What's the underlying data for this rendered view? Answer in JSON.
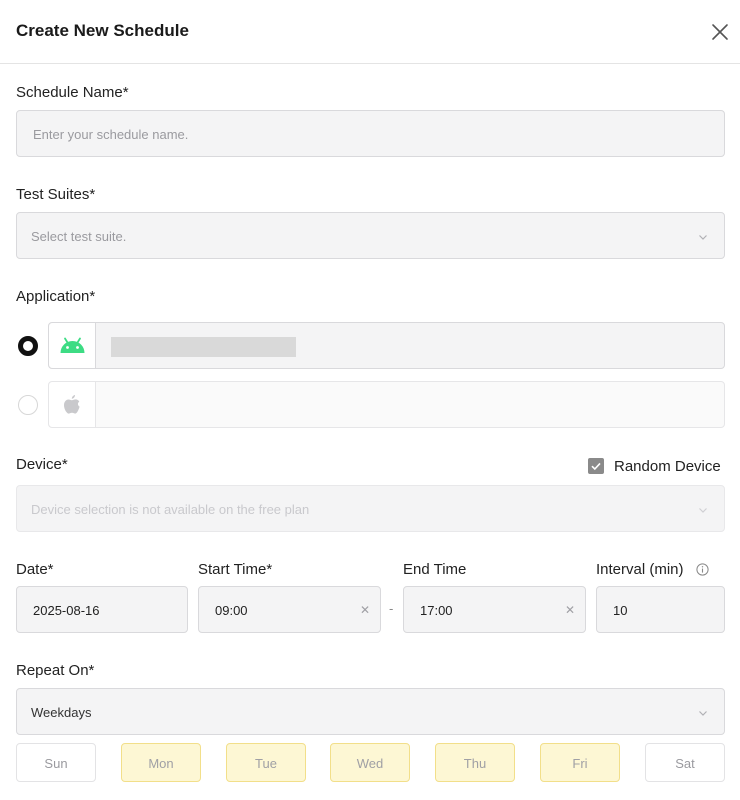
{
  "header": {
    "title": "Create New Schedule",
    "close_icon": "close-icon"
  },
  "schedule_name": {
    "label": "Schedule Name*",
    "placeholder": "Enter your schedule name."
  },
  "test_suites": {
    "label": "Test Suites*",
    "placeholder": "Select test suite."
  },
  "application": {
    "label": "Application*",
    "options": [
      {
        "platform": "android",
        "icon": "android-icon",
        "selected": true,
        "name_redacted": true
      },
      {
        "platform": "ios",
        "icon": "apple-icon",
        "selected": false
      }
    ]
  },
  "device": {
    "label": "Device*",
    "placeholder": "Device selection is not available on the free plan",
    "random_device_label": "Random Device",
    "random_device_checked": true
  },
  "date": {
    "label": "Date*",
    "value": "2025-08-16"
  },
  "start_time": {
    "label": "Start Time*",
    "value": "09:00"
  },
  "end_time": {
    "label": "End Time",
    "value": "17:00"
  },
  "separator": "-",
  "interval": {
    "label": "Interval (min)",
    "value": "10",
    "info_icon": "info-icon"
  },
  "repeat_on": {
    "label": "Repeat On*",
    "selected": "Weekdays",
    "days": [
      {
        "label": "Sun",
        "active": false
      },
      {
        "label": "Mon",
        "active": true
      },
      {
        "label": "Tue",
        "active": true
      },
      {
        "label": "Wed",
        "active": true
      },
      {
        "label": "Thu",
        "active": true
      },
      {
        "label": "Fri",
        "active": true
      },
      {
        "label": "Sat",
        "active": false
      }
    ]
  },
  "colors": {
    "selected_day_bg": "#fdf7d4",
    "selected_day_border": "#f2df8a",
    "android_green": "#3ddc84"
  }
}
